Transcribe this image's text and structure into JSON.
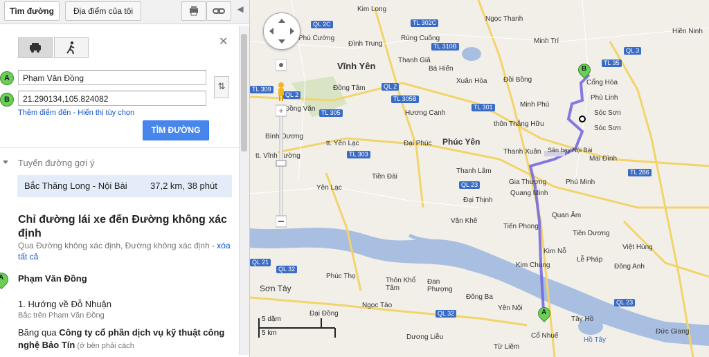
{
  "top_tabs": {
    "directions": "Tìm đường",
    "my_places": "Địa điểm của tôi"
  },
  "form": {
    "marker_a": "A",
    "marker_b": "B",
    "start_value": "Phạm Văn Đồng",
    "end_value": "21.290134,105.824082",
    "add_dest_link": "Thêm điểm đến - Hiển thị tùy chọn",
    "go_button": "TÌM ĐƯỜNG"
  },
  "suggestions": {
    "heading": "Tuyến đường gợi ý",
    "route_name": "Bắc Thăng Long - Nội Bài",
    "route_info": "37,2 km, 38 phút"
  },
  "directions": {
    "title": "Chỉ đường lái xe đến Đường không xác định",
    "via_text": "Qua Đường không xác định, Đường không xác định - ",
    "clear_all": "xóa tất cả",
    "start_name": "Phạm Văn Đồng",
    "step1_title": "1. Hướng về Đỗ Nhuận",
    "step1_sub": "Bắc trên Phạm Văn Đồng",
    "step1_text_a": "Băng qua ",
    "step1_bold": "Công ty cổ phần dịch vụ kỹ thuật công nghệ Bảo Tín",
    "step1_small": " (ở bên phải cách"
  },
  "map": {
    "scale_mi": "5 dặm",
    "scale_km": "5 km",
    "labels": [
      {
        "t": "Kim Long"
      },
      {
        "t": "Ngọc Thanh"
      },
      {
        "t": "Phú Cường"
      },
      {
        "t": "Rùng Cuông"
      },
      {
        "t": "Minh Trí"
      },
      {
        "t": "Đình Trung"
      },
      {
        "t": "Vĩnh Yên"
      },
      {
        "t": "Thanh Giã"
      },
      {
        "t": "Bá Hiến"
      },
      {
        "t": "Cổng Hòa"
      },
      {
        "t": "Xuân Hòa"
      },
      {
        "t": "Đồi Bồng"
      },
      {
        "t": "Phù Linh"
      },
      {
        "t": "Đồng Tâm"
      },
      {
        "t": "Minh Phú"
      },
      {
        "t": "Sóc Sơn"
      },
      {
        "t": "Hương Canh"
      },
      {
        "t": "thôn Thắng Hữu"
      },
      {
        "t": "Bình Dương"
      },
      {
        "t": "tt. Yên Lạc"
      },
      {
        "t": "Đại Phúc"
      },
      {
        "t": "Phúc Yên"
      },
      {
        "t": "Thanh Xuân"
      },
      {
        "t": "Sân bay Nội Bài"
      },
      {
        "t": "Mai Đình"
      },
      {
        "t": "tt. Vĩnh Tường"
      },
      {
        "t": "Thanh Lâm"
      },
      {
        "t": "Tiền Đài"
      },
      {
        "t": "Yên Lạc"
      },
      {
        "t": "Gia Thượng"
      },
      {
        "t": "Quang Minh"
      },
      {
        "t": "Phù Minh"
      },
      {
        "t": "Đại Thịnh"
      },
      {
        "t": "Quan Âm"
      },
      {
        "t": "Tiến Phong"
      },
      {
        "t": "Tiền Dương"
      },
      {
        "t": "Văn Khê"
      },
      {
        "t": "Kim Nỗ"
      },
      {
        "t": "Lễ Pháp"
      },
      {
        "t": "Kim Chung"
      },
      {
        "t": "Phúc Thọ"
      },
      {
        "t": "Thôn Khổ Tâm"
      },
      {
        "t": "Đan Phượng"
      },
      {
        "t": "Đông Ba"
      },
      {
        "t": "Ngọc Tảo"
      },
      {
        "t": "Đại Đồng"
      },
      {
        "t": "Yên Nội"
      },
      {
        "t": "Tây Hồ"
      },
      {
        "t": "Cổ Nhuế"
      },
      {
        "t": "Dương Liễu"
      },
      {
        "t": "Từ Liêm"
      },
      {
        "t": "Hồ Tây"
      },
      {
        "t": "Đức Giang"
      },
      {
        "t": "Việt Hùng"
      },
      {
        "t": "Đông Anh"
      },
      {
        "t": "Sơn Tây"
      },
      {
        "t": "Đồng Văn"
      },
      {
        "t": "Sóc Sơn"
      },
      {
        "t": "Hiền Ninh"
      }
    ],
    "shields": [
      "QL 2C",
      "TL 302C",
      "QL 3",
      "TL 309",
      "QL 2",
      "TL 310B",
      "TL 305B",
      "QL 2",
      "TL 301",
      "TL 305",
      "TL 303",
      "QL 23",
      "TL 35",
      "TL 286",
      "QL 21",
      "QL 32",
      "QL 32",
      "QL 23"
    ]
  }
}
